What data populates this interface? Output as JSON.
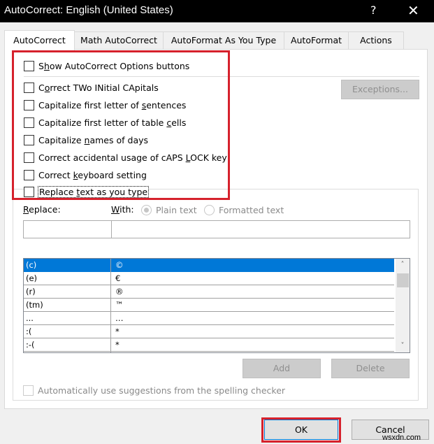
{
  "window": {
    "title": "AutoCorrect: English (United States)",
    "help_glyph": "?",
    "close_glyph": "✕"
  },
  "tabs": [
    {
      "label": "AutoCorrect",
      "active": true
    },
    {
      "label": "Math AutoCorrect",
      "active": false
    },
    {
      "label": "AutoFormat As You Type",
      "active": false
    },
    {
      "label": "AutoFormat",
      "active": false
    },
    {
      "label": "Actions",
      "active": false
    }
  ],
  "options": {
    "show_buttons": {
      "pre": "S",
      "ul": "h",
      "post": "ow AutoCorrect Options buttons",
      "checked": false
    },
    "two_initial": {
      "pre": "C",
      "ul": "o",
      "post": "rrect TWo INitial CApitals",
      "checked": false
    },
    "first_letter_sentences": {
      "pre": "Capitalize first letter of ",
      "ul": "s",
      "post": "entences",
      "checked": false
    },
    "first_letter_table": {
      "pre": "Capitalize first letter of table ",
      "ul": "c",
      "post": "ells",
      "checked": false
    },
    "names_of_days": {
      "pre": "Capitalize ",
      "ul": "n",
      "post": "ames of days",
      "checked": false
    },
    "caps_lock": {
      "pre": "Correct accidental usage of cAPS ",
      "ul": "L",
      "post": "OCK key",
      "checked": false
    },
    "keyboard": {
      "pre": "Correct ",
      "ul": "k",
      "post": "eyboard setting",
      "checked": false
    },
    "replace_text": {
      "pre": "Replace ",
      "ul": "t",
      "post": "ext as you type",
      "checked": false
    }
  },
  "exceptions_button": "Exceptions...",
  "replace": {
    "replace_label_ul": "R",
    "replace_label_rest": "eplace:",
    "with_label_ul": "W",
    "with_label_rest": "ith:",
    "plain_text": "Plain text",
    "formatted_text": "Formatted text",
    "plain_selected": true,
    "replace_value": "",
    "with_value": ""
  },
  "entries": [
    {
      "replace": "(c)",
      "with": "©",
      "selected": true
    },
    {
      "replace": "(e)",
      "with": "€",
      "selected": false
    },
    {
      "replace": "(r)",
      "with": "®",
      "selected": false
    },
    {
      "replace": "(tm)",
      "with": "™",
      "selected": false
    },
    {
      "replace": "...",
      "with": "…",
      "selected": false
    },
    {
      "replace": ":(",
      "with": "*",
      "selected": false
    },
    {
      "replace": ":-(",
      "with": "*",
      "selected": false
    }
  ],
  "buttons": {
    "add": "Add",
    "delete": "Delete",
    "ok": "OK",
    "cancel": "Cancel"
  },
  "spelling_suggestions": {
    "label": "Automatically use suggestions from the spelling checker",
    "checked": false
  },
  "watermark": "wsxdn.com",
  "colors": {
    "highlight": "#d6212c",
    "selection": "#0078d7"
  }
}
